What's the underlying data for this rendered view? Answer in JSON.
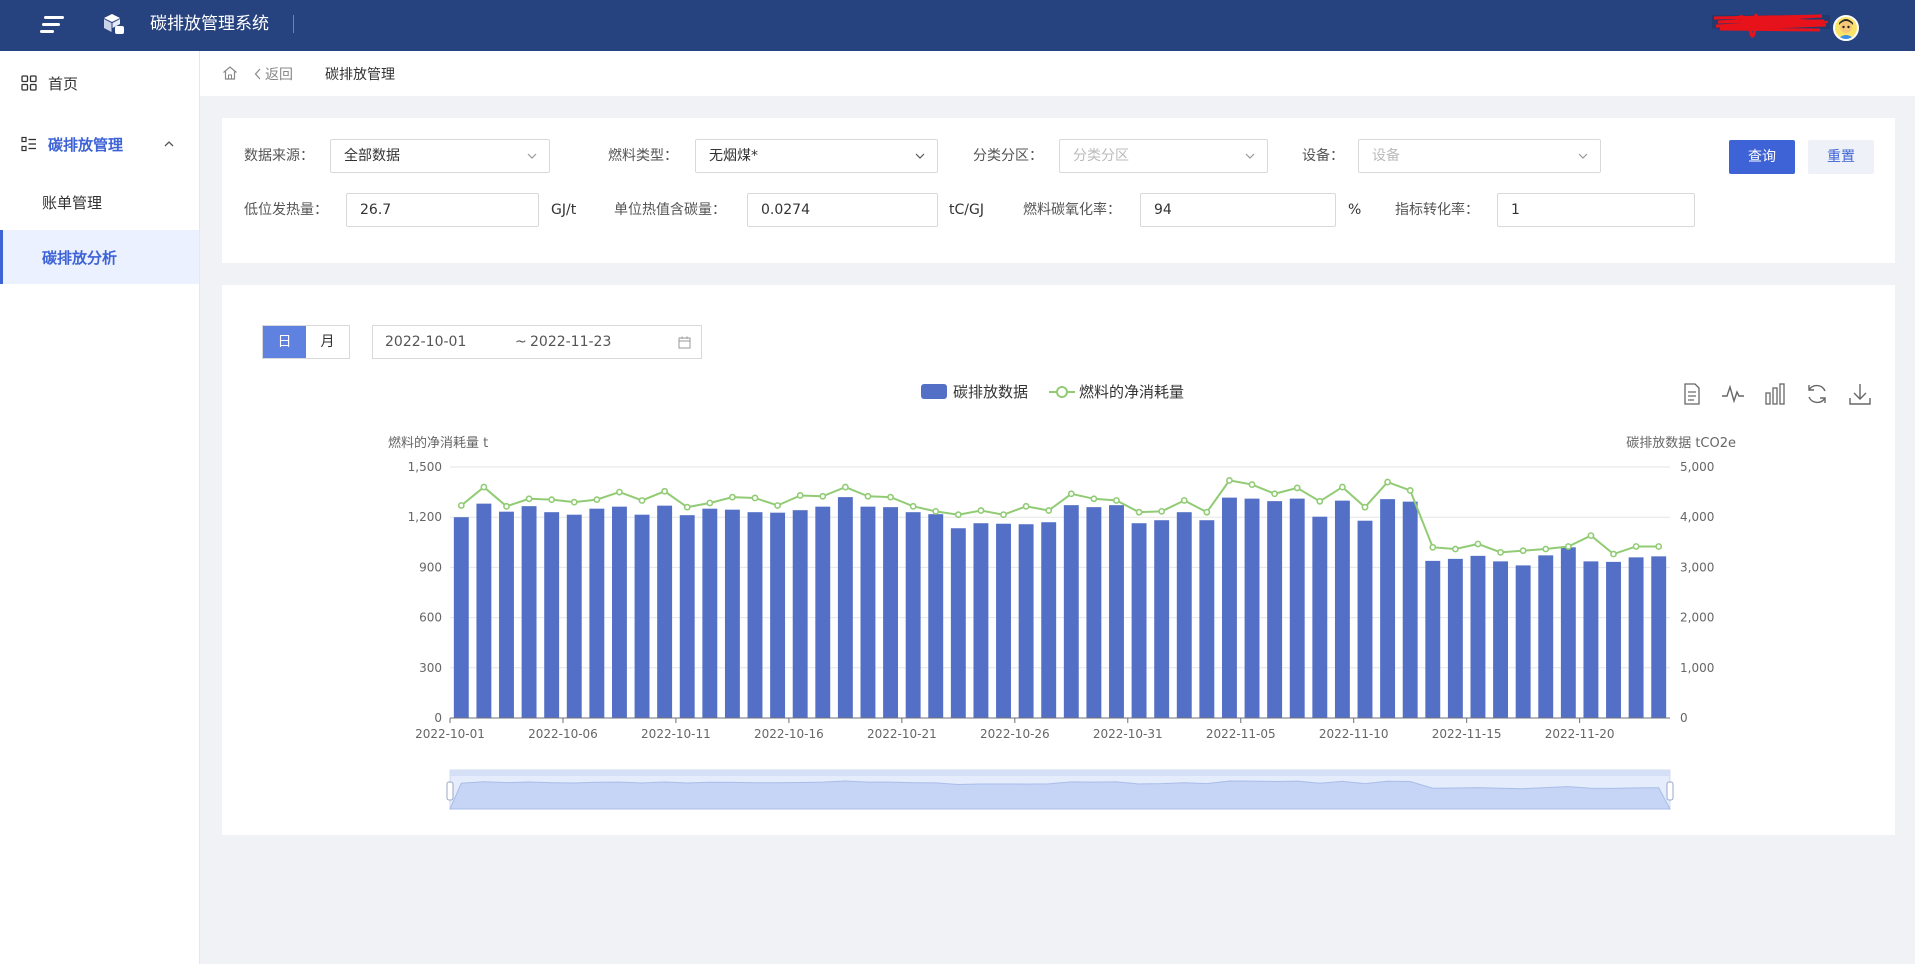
{
  "app": {
    "title": "碳排放管理系统"
  },
  "sidebar": {
    "items": [
      {
        "label": "首页"
      },
      {
        "label": "碳排放管理"
      },
      {
        "label": "账单管理"
      },
      {
        "label": "碳排放分析"
      }
    ]
  },
  "breadcrumb": {
    "back": "返回",
    "current": "碳排放管理"
  },
  "filters": {
    "source_label": "数据来源：",
    "source_value": "全部数据",
    "fuel_label": "燃料类型：",
    "fuel_value": "无烟煤*",
    "zone_label": "分类分区：",
    "zone_placeholder": "分类分区",
    "device_label": "设备：",
    "device_placeholder": "设备",
    "query_label": "查询",
    "reset_label": "重置",
    "lhv_label": "低位发热量：",
    "lhv_value": "26.7",
    "lhv_unit": "GJ/t",
    "carbon_label": "单位热值含碳量：",
    "carbon_value": "0.0274",
    "carbon_unit": "tC/GJ",
    "oxid_label": "燃料碳氧化率：",
    "oxid_value": "94",
    "oxid_unit": "%",
    "index_label": "指标转化率：",
    "index_value": "1"
  },
  "period_toggle": {
    "day": "日",
    "month": "月"
  },
  "date_range": {
    "start": "2022-10-01",
    "sep": "~",
    "end": "2022-11-23"
  },
  "colors": {
    "bar": "#5470c6",
    "line": "#91cc75",
    "primary": "#3e63d6",
    "topbar": "#27437f"
  },
  "chart_data": {
    "type": "bar",
    "left_axis_name": "燃料的净消耗量 t",
    "right_axis_name": "碳排放数据 tCO2e",
    "left_ticks": [
      "0",
      "300",
      "600",
      "900",
      "1,200",
      "1,500"
    ],
    "right_ticks": [
      "0",
      "1,000",
      "2,000",
      "3,000",
      "4,000",
      "5,000"
    ],
    "ylim_left": [
      0,
      1500
    ],
    "ylim_right": [
      0,
      5000
    ],
    "x_tick_labels": [
      "2022-10-01",
      "2022-10-06",
      "2022-10-11",
      "2022-10-16",
      "2022-10-21",
      "2022-10-26",
      "2022-10-31",
      "2022-11-05",
      "2022-11-10",
      "2022-11-15",
      "2022-11-20"
    ],
    "x": [
      "2022-10-01",
      "2022-10-02",
      "2022-10-03",
      "2022-10-04",
      "2022-10-05",
      "2022-10-06",
      "2022-10-07",
      "2022-10-08",
      "2022-10-09",
      "2022-10-10",
      "2022-10-11",
      "2022-10-12",
      "2022-10-13",
      "2022-10-14",
      "2022-10-15",
      "2022-10-16",
      "2022-10-17",
      "2022-10-18",
      "2022-10-19",
      "2022-10-20",
      "2022-10-21",
      "2022-10-22",
      "2022-10-23",
      "2022-10-24",
      "2022-10-25",
      "2022-10-26",
      "2022-10-27",
      "2022-10-28",
      "2022-10-29",
      "2022-10-30",
      "2022-10-31",
      "2022-11-01",
      "2022-11-02",
      "2022-11-03",
      "2022-11-04",
      "2022-11-05",
      "2022-11-06",
      "2022-11-07",
      "2022-11-08",
      "2022-11-09",
      "2022-11-10",
      "2022-11-11",
      "2022-11-12",
      "2022-11-13",
      "2022-11-14",
      "2022-11-15",
      "2022-11-16",
      "2022-11-17",
      "2022-11-18",
      "2022-11-19",
      "2022-11-20",
      "2022-11-21",
      "2022-11-22",
      "2022-11-23"
    ],
    "series": [
      {
        "name": "碳排放数据",
        "type": "bar",
        "axis": "right",
        "values": [
          4000,
          4270,
          4110,
          4220,
          4100,
          4050,
          4170,
          4210,
          4050,
          4230,
          4040,
          4170,
          4150,
          4100,
          4090,
          4140,
          4210,
          4400,
          4210,
          4200,
          4100,
          4060,
          3780,
          3880,
          3870,
          3860,
          3900,
          4240,
          4200,
          4240,
          3880,
          3940,
          4100,
          3940,
          4390,
          4370,
          4320,
          4370,
          4010,
          4330,
          3930,
          4360,
          4310,
          3130,
          3170,
          3230,
          3120,
          3040,
          3240,
          3400,
          3120,
          3110,
          3200,
          3220
        ]
      },
      {
        "name": "燃料的净消耗量",
        "type": "line",
        "axis": "left",
        "values": [
          1270,
          1380,
          1265,
          1310,
          1305,
          1290,
          1305,
          1350,
          1300,
          1355,
          1260,
          1285,
          1320,
          1315,
          1270,
          1330,
          1325,
          1380,
          1325,
          1320,
          1265,
          1235,
          1215,
          1240,
          1215,
          1265,
          1240,
          1340,
          1310,
          1300,
          1230,
          1235,
          1300,
          1230,
          1420,
          1395,
          1340,
          1375,
          1295,
          1380,
          1260,
          1410,
          1360,
          1020,
          1010,
          1040,
          990,
          1000,
          1010,
          1025,
          1090,
          980,
          1025,
          1025
        ]
      }
    ]
  }
}
